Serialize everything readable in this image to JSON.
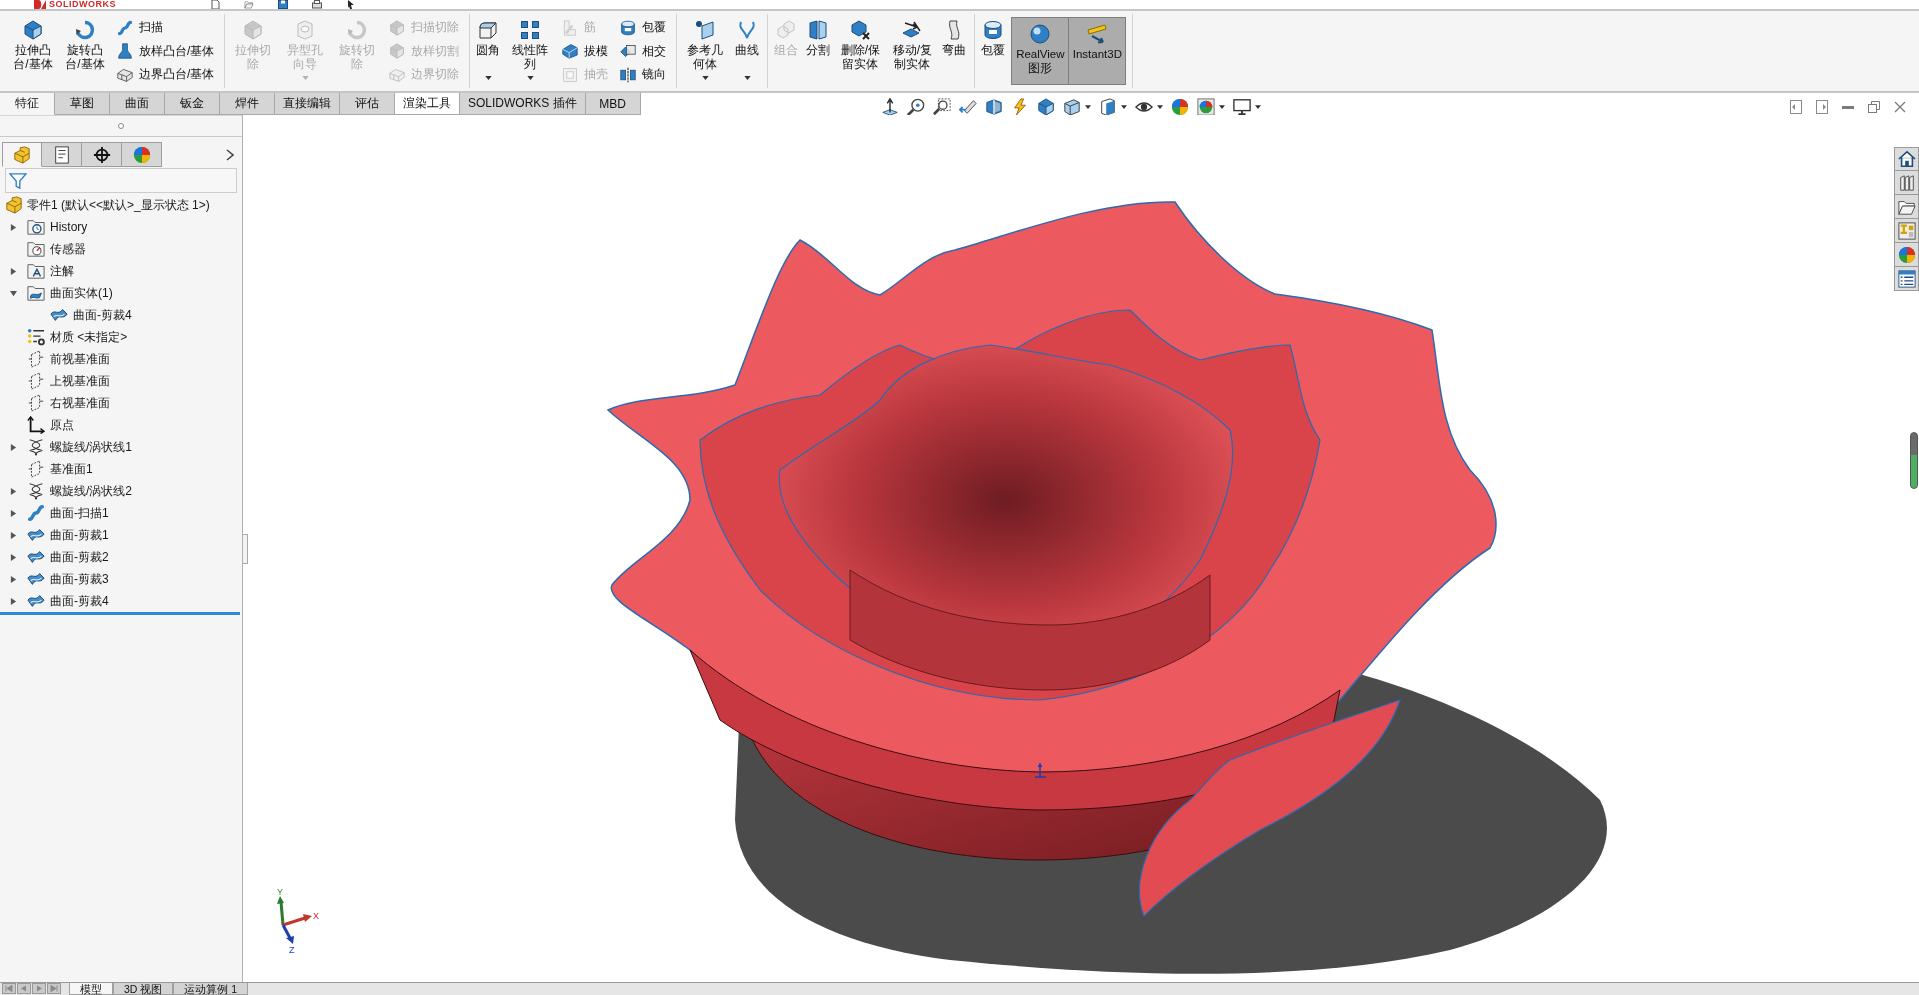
{
  "title_bar": {
    "logo": "SOLIDWORKS"
  },
  "ribbon": {
    "groups": [
      {
        "items": [
          {
            "kind": "large",
            "label": "拉伸凸台/基体",
            "disabled": false
          },
          {
            "kind": "large",
            "label": "旋转凸台/基体",
            "disabled": false
          },
          {
            "kind": "stack",
            "items": [
              {
                "label": "扫描",
                "disabled": false
              },
              {
                "label": "放样凸台/基体",
                "disabled": false
              },
              {
                "label": "边界凸台/基体",
                "disabled": false
              }
            ]
          }
        ]
      },
      {
        "items": [
          {
            "kind": "large",
            "label": "拉伸切除",
            "disabled": true
          },
          {
            "kind": "large",
            "label": "异型孔向导",
            "disabled": true,
            "dropdown": true
          },
          {
            "kind": "large",
            "label": "旋转切除",
            "disabled": true
          },
          {
            "kind": "stack",
            "items": [
              {
                "label": "扫描切除",
                "disabled": true
              },
              {
                "label": "放样切割",
                "disabled": true
              },
              {
                "label": "边界切除",
                "disabled": true
              }
            ]
          }
        ]
      },
      {
        "items": [
          {
            "kind": "large",
            "label": "圆角",
            "disabled": false,
            "dropdown": true
          },
          {
            "kind": "large",
            "label": "线性阵列",
            "disabled": false,
            "dropdown": true
          },
          {
            "kind": "stack",
            "items": [
              {
                "label": "筋",
                "disabled": true
              },
              {
                "label": "拔模",
                "disabled": false
              },
              {
                "label": "抽壳",
                "disabled": true
              }
            ]
          },
          {
            "kind": "stack",
            "items": [
              {
                "label": "包覆",
                "disabled": false
              },
              {
                "label": "相交",
                "disabled": false
              },
              {
                "label": "镜向",
                "disabled": false
              }
            ]
          }
        ]
      },
      {
        "items": [
          {
            "kind": "large",
            "label": "参考几何体",
            "disabled": false,
            "dropdown": true
          },
          {
            "kind": "large",
            "label": "曲线",
            "disabled": false,
            "dropdown": true
          }
        ]
      },
      {
        "items": [
          {
            "kind": "large",
            "label": "组合",
            "disabled": true
          },
          {
            "kind": "large",
            "label": "分割",
            "disabled": false
          },
          {
            "kind": "large",
            "label": "删除/保留实体",
            "disabled": false
          },
          {
            "kind": "large",
            "label": "移动/复制实体",
            "disabled": false
          },
          {
            "kind": "large",
            "label": "弯曲",
            "disabled": false
          }
        ]
      },
      {
        "items": [
          {
            "kind": "large",
            "label": "包覆",
            "disabled": false
          },
          {
            "kind": "toggle",
            "label": "RealView图形",
            "pressed": true
          },
          {
            "kind": "toggle",
            "label": "Instant3D",
            "pressed": true
          }
        ]
      }
    ]
  },
  "tabs": [
    {
      "label": "特征",
      "selected": true,
      "highlighted": false
    },
    {
      "label": "草图",
      "selected": false,
      "highlighted": false
    },
    {
      "label": "曲面",
      "selected": false,
      "highlighted": false
    },
    {
      "label": "钣金",
      "selected": false,
      "highlighted": false
    },
    {
      "label": "焊件",
      "selected": false,
      "highlighted": false
    },
    {
      "label": "直接编辑",
      "selected": false,
      "highlighted": false
    },
    {
      "label": "评估",
      "selected": false,
      "highlighted": false
    },
    {
      "label": "渲染工具",
      "selected": false,
      "highlighted": true
    },
    {
      "label": "SOLIDWORKS 插件",
      "selected": false,
      "highlighted": false
    },
    {
      "label": "MBD",
      "selected": false,
      "highlighted": false
    }
  ],
  "feature_manager": {
    "tabs": [
      {
        "selected": true
      },
      {
        "selected": false
      },
      {
        "selected": false
      },
      {
        "selected": false
      }
    ],
    "tree": {
      "root": "零件1 (默认<<默认>_显示状态 1>)",
      "items": [
        {
          "kind": "history",
          "label": "History",
          "expanded": false
        },
        {
          "kind": "sensors",
          "label": "传感器"
        },
        {
          "kind": "annotations",
          "label": "注解",
          "expanded": false
        },
        {
          "kind": "bodies",
          "label": "曲面实体(1)",
          "expanded": true,
          "children": [
            {
              "kind": "surface",
              "label": "曲面-剪裁4"
            }
          ]
        },
        {
          "kind": "material",
          "label": "材质 <未指定>"
        },
        {
          "kind": "plane",
          "label": "前视基准面"
        },
        {
          "kind": "plane",
          "label": "上视基准面"
        },
        {
          "kind": "plane",
          "label": "右视基准面"
        },
        {
          "kind": "origin",
          "label": "原点"
        },
        {
          "kind": "helix",
          "label": "螺旋线/涡状线1",
          "expanded": false
        },
        {
          "kind": "plane",
          "label": "基准面1"
        },
        {
          "kind": "helix",
          "label": "螺旋线/涡状线2",
          "expanded": false
        },
        {
          "kind": "sweep",
          "label": "曲面-扫描1",
          "expanded": false
        },
        {
          "kind": "trim",
          "label": "曲面-剪裁1",
          "expanded": false
        },
        {
          "kind": "trim",
          "label": "曲面-剪裁2",
          "expanded": false
        },
        {
          "kind": "trim",
          "label": "曲面-剪裁3",
          "expanded": false
        },
        {
          "kind": "trim",
          "label": "曲面-剪裁4",
          "expanded": false
        }
      ]
    }
  },
  "triad": {
    "x": "X",
    "y": "Y",
    "z": "Z"
  },
  "bottom_tabs": [
    {
      "label": "模型",
      "selected": true
    },
    {
      "label": "3D 视图",
      "selected": false
    },
    {
      "label": "运动算例 1",
      "selected": false
    }
  ]
}
